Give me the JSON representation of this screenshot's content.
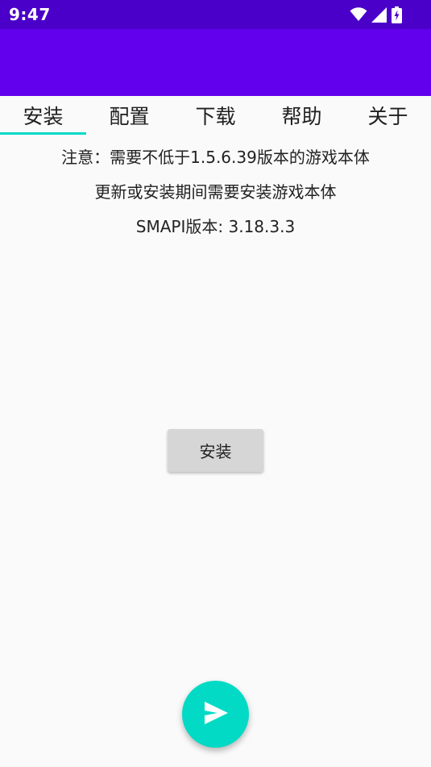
{
  "status_bar": {
    "time": "9:47",
    "icons": [
      "wifi-icon",
      "cellular-signal-icon",
      "battery-charging-icon"
    ],
    "color": "#4B00C9"
  },
  "app_bar": {
    "color": "#6200EE"
  },
  "tabs": [
    {
      "label": "安装",
      "active": true
    },
    {
      "label": "配置",
      "active": false
    },
    {
      "label": "下载",
      "active": false
    },
    {
      "label": "帮助",
      "active": false
    },
    {
      "label": "关于",
      "active": false
    }
  ],
  "accent_color": "#03DAC5",
  "content": {
    "notice_line1": "注意：需要不低于1.5.6.39版本的游戏本体",
    "notice_line2": "更新或安装期间需要安装游戏本体",
    "smapi_version": "SMAPI版本: 3.18.3.3"
  },
  "install_button": {
    "label": "安装"
  },
  "fab": {
    "icon": "send-icon"
  }
}
